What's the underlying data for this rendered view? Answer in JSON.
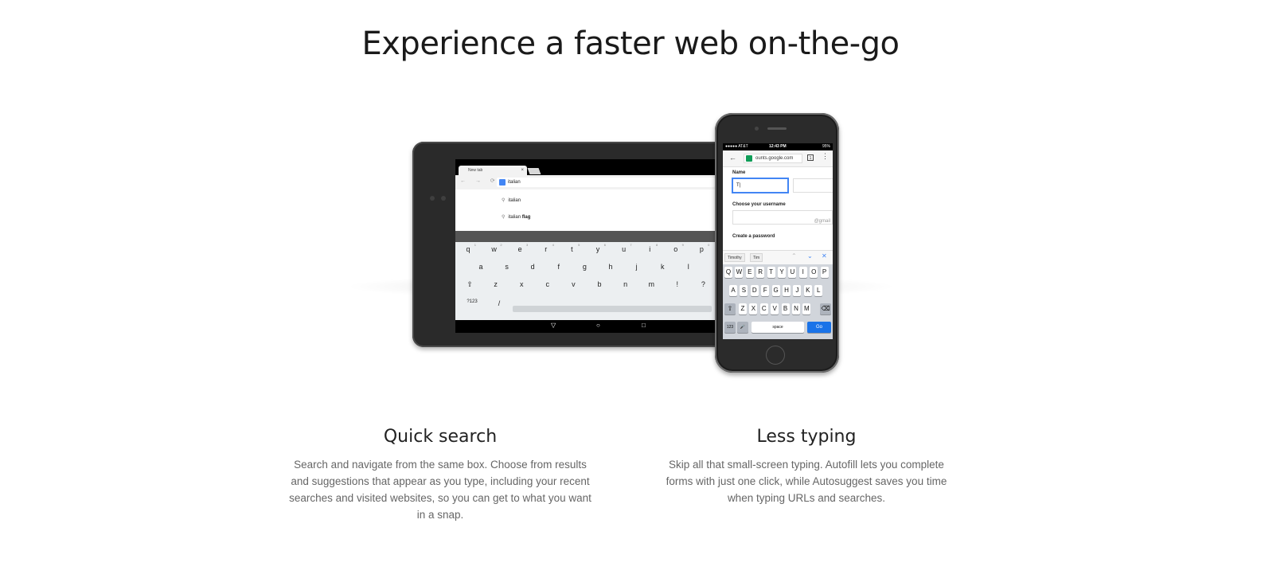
{
  "headline": "Experience a faster web on-the-go",
  "tablet": {
    "tab_title": "New tab",
    "tab_close": "×",
    "omnibox_value": "italian",
    "suggestions": [
      {
        "text": "italian",
        "bold": ""
      },
      {
        "text": "italian",
        "bold": "flag"
      }
    ],
    "keyboard_rows": [
      [
        "q",
        "w",
        "e",
        "r",
        "t",
        "y",
        "u",
        "i",
        "o",
        "p"
      ],
      [
        "a",
        "s",
        "d",
        "f",
        "g",
        "h",
        "j",
        "k",
        "l"
      ],
      [
        "⇧",
        "z",
        "x",
        "c",
        "v",
        "b",
        "n",
        "m",
        "!",
        "?"
      ],
      [
        "?123",
        "/"
      ]
    ],
    "number_hints": [
      "1",
      "2",
      "3",
      "4",
      "5",
      "6",
      "7",
      "8",
      "9",
      "0"
    ],
    "nav_buttons": [
      "▽",
      "○",
      "□"
    ]
  },
  "phone": {
    "status_left": "●●●●● AT&T",
    "status_time": "12:43 PM",
    "status_right": "95%",
    "back": "←",
    "url": "ounts.google.com",
    "tab_count": "1",
    "menu": "⋮",
    "name_label": "Name",
    "name_value": "T",
    "username_label": "Choose your username",
    "username_suffix": "@gmail",
    "password_label": "Create a password",
    "autofill_chips": [
      "Timothy",
      "Tim"
    ],
    "autofill_nav": [
      "⌃",
      "⌄",
      "✕"
    ],
    "keyboard_rows": [
      [
        "Q",
        "W",
        "E",
        "R",
        "T",
        "Y",
        "U",
        "I",
        "O",
        "P"
      ],
      [
        "A",
        "S",
        "D",
        "F",
        "G",
        "H",
        "J",
        "K",
        "L"
      ],
      [
        "⇧",
        "Z",
        "X",
        "C",
        "V",
        "B",
        "N",
        "M",
        "⌫"
      ]
    ],
    "key_123": "123",
    "key_mic": "🎤",
    "key_space": "space",
    "key_go": "Go"
  },
  "features": [
    {
      "title": "Quick search",
      "body": "Search and navigate from the same box. Choose from results and suggestions that appear as you type, including your recent searches and visited websites, so you can get to what you want in a snap."
    },
    {
      "title": "Less typing",
      "body": "Skip all that small-screen typing. Autofill lets you complete forms with just one click, while Autosuggest saves you time when typing URLs and searches."
    }
  ]
}
